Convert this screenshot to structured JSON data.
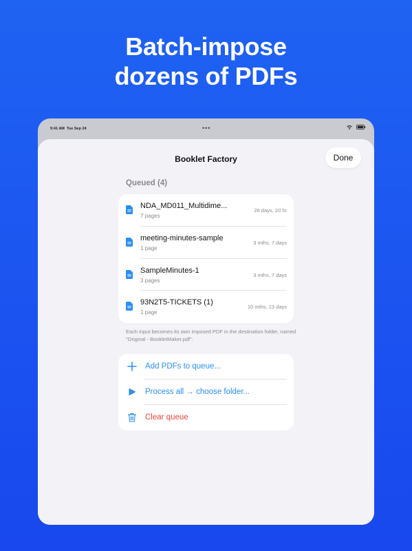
{
  "headline": {
    "line1": "Batch-impose",
    "line2": "dozens of PDFs"
  },
  "status_bar": {
    "time": "9:41 AM",
    "date": "Tue Sep 24",
    "dots": "•••"
  },
  "nav": {
    "title": "Booklet Factory",
    "done_label": "Done"
  },
  "queue": {
    "header": "Queued (4)",
    "files": [
      {
        "name": "NDA_MD011_Multidime...",
        "pages": "7 pages",
        "age": "26 days, 20 hr"
      },
      {
        "name": "meeting-minutes-sample",
        "pages": "1 page",
        "age": "3 mths, 7 days"
      },
      {
        "name": "SampleMinutes-1",
        "pages": "3 pages",
        "age": "3 mths, 7 days"
      },
      {
        "name": "93N2T5-TICKETS (1)",
        "pages": "1 page",
        "age": "10 mths, 13 days"
      }
    ],
    "footnote": "Each input becomes its own imposed PDF in the destination folder, named \"Original - BookletMaker.pdf\"."
  },
  "actions": {
    "add": {
      "label": "Add PDFs to queue...",
      "icon": "plus-icon"
    },
    "process": {
      "label": "Process all → choose folder...",
      "icon": "play-icon"
    },
    "clear": {
      "label": "Clear queue",
      "icon": "trash-icon"
    }
  },
  "colors": {
    "background": "#1f5af0",
    "accent": "#2a8ff0",
    "destructive": "#f0453c",
    "sheet": "#f2f2f7"
  }
}
